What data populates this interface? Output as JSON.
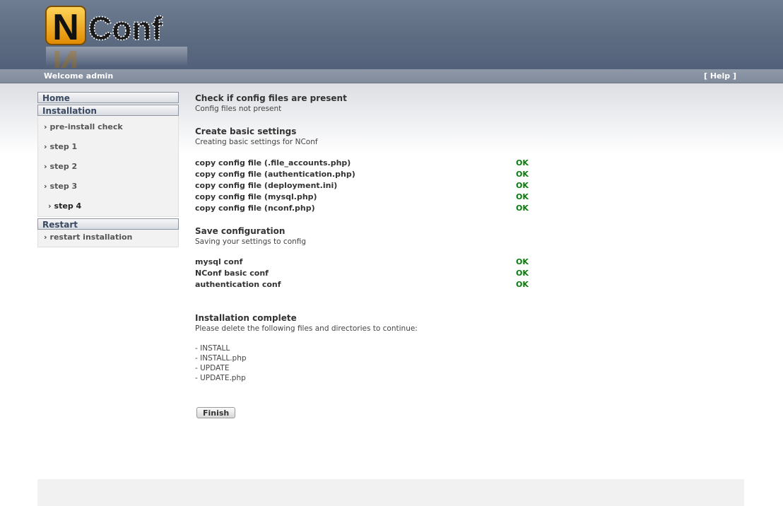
{
  "header": {
    "logo_text": "NConf",
    "welcome": "Welcome admin",
    "help": "[ Help ]"
  },
  "sidebar": {
    "home": "Home",
    "installation": "Installation",
    "install_items": [
      {
        "label": "pre-install check"
      },
      {
        "label": "step 1"
      },
      {
        "label": "step 2"
      },
      {
        "label": "step 3"
      },
      {
        "label": "step 4"
      }
    ],
    "restart": "Restart",
    "restart_item": "restart installation"
  },
  "main": {
    "check": {
      "title": "Check if config files are present",
      "subtitle": "Config files not present"
    },
    "basic": {
      "title": "Create basic settings",
      "subtitle": "Creating basic settings for NConf",
      "rows": [
        {
          "label": "copy config file (.file_accounts.php)",
          "status": "OK"
        },
        {
          "label": "copy config file (authentication.php)",
          "status": "OK"
        },
        {
          "label": "copy config file (deployment.ini)",
          "status": "OK"
        },
        {
          "label": "copy config file (mysql.php)",
          "status": "OK"
        },
        {
          "label": "copy config file (nconf.php)",
          "status": "OK"
        }
      ]
    },
    "save": {
      "title": "Save configuration",
      "subtitle": "Saving your settings to config",
      "rows": [
        {
          "label": "mysql conf",
          "status": "OK"
        },
        {
          "label": "NConf basic conf",
          "status": "OK"
        },
        {
          "label": "authentication conf",
          "status": "OK"
        }
      ]
    },
    "complete": {
      "title": "Installation complete",
      "subtitle": "Please delete the following files and directories to continue:",
      "files": [
        "- INSTALL",
        "- INSTALL.php",
        "- UPDATE",
        "- UPDATE.php"
      ]
    },
    "finish_label": "Finish"
  },
  "colors": {
    "header_bg": "#5f6d83",
    "ok": "#0a7a0a",
    "logo_accent": "#f0a800"
  }
}
